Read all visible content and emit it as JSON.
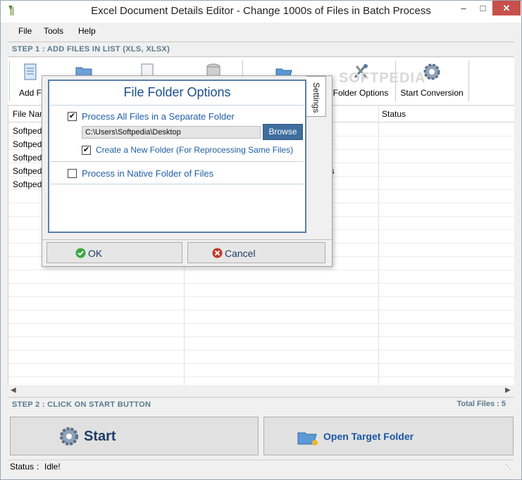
{
  "window": {
    "title": "Excel Document Details Editor - Change 1000s of Files in Batch Process"
  },
  "menu": {
    "items": [
      "File",
      "Tools",
      "Help"
    ]
  },
  "step1": {
    "label": "STEP 1 : ADD FILES IN LIST (XLS, XLSX)"
  },
  "toolbar": {
    "add_files_label": "Add F",
    "folder_options_label": "Folder Options",
    "start_conversion_label": "Start Conversion"
  },
  "watermark": "SOFTPEDIA",
  "table": {
    "columns": [
      "File Nam",
      "Status"
    ],
    "rows": [
      {
        "file": "Softped",
        "extra": ""
      },
      {
        "file": "Softped",
        "extra": ""
      },
      {
        "file": "Softped",
        "extra": ""
      },
      {
        "file": "Softped",
        "extra": "ls"
      },
      {
        "file": "Softped",
        "extra": ""
      }
    ]
  },
  "step2": {
    "label": "STEP 2 : CLICK ON START BUTTON",
    "total_files": "Total Files : 5"
  },
  "buttons": {
    "start": "Start",
    "open_target": "Open Target Folder"
  },
  "status": {
    "label": "Status",
    "separator": ":",
    "value": "Idle!"
  },
  "dialog": {
    "title": "File Folder Options",
    "tab_label": "Settings",
    "option_separate": "Process All Files in a Separate Folder",
    "option_separate_checked": true,
    "path_value": "C:\\Users\\Softpedia\\Desktop",
    "browse_label": "Browse",
    "option_new_folder": "Create a New Folder (For Reprocessing Same Files)",
    "option_new_folder_checked": true,
    "option_native": "Process in Native Folder of Files",
    "option_native_checked": false,
    "ok_label": "OK",
    "cancel_label": "Cancel"
  },
  "colors": {
    "accent_blue": "#1f5fa6",
    "step_text": "#5a7a8e",
    "close_red": "#c7504a",
    "ok_green": "#3aa843",
    "cancel_red": "#c0392b"
  }
}
